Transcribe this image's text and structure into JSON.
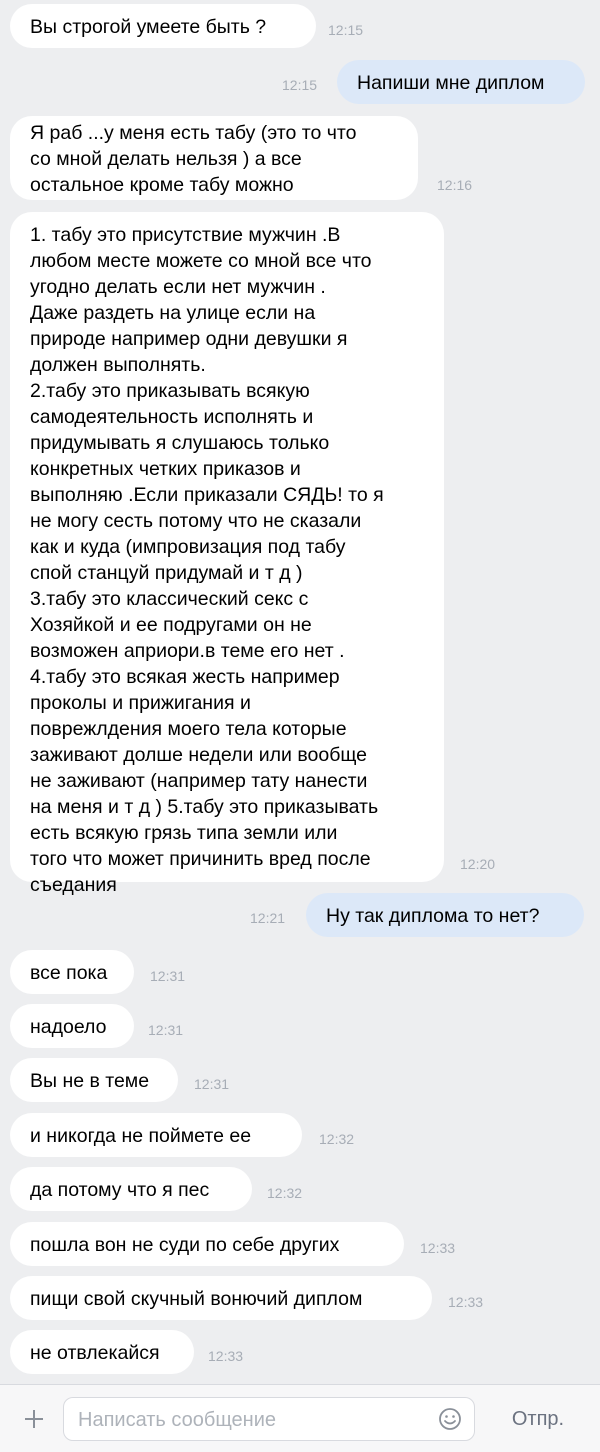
{
  "messages": [
    {
      "dir": "in",
      "text": "Вы строгой умеете быть ?",
      "time": "12:15"
    },
    {
      "dir": "out",
      "text": "Напиши мне диплом",
      "time": "12:15"
    },
    {
      "dir": "in",
      "text": "Я раб ...у меня есть табу (это то что\nсо мной делать нельзя ) а все\nостальное кроме табу можно",
      "time": "12:16"
    },
    {
      "dir": "in",
      "text": "1. табу это присутствие мужчин .В\nлюбом месте можете со мной все что\nугодно делать если нет мужчин .\nДаже раздеть на улице если на\nприроде например одни девушки я\nдолжен выполнять.\n2.табу это приказывать всякую\nсамодеятельность исполнять и\nпридумывать я слушаюсь только\nконкретных четких приказов и\nвыполняю .Если приказали СЯДЬ! то я\nне могу сесть потому что не сказали\nкак и куда (импровизация под табу\nспой станцуй придумай и т д )\n3.табу это классический секс с\nХозяйкой и ее подругами он не\nвозможен априори.в теме его нет .\n4.табу это всякая жесть например\nпроколы и прижигания и\nповрежлдения моего тела которые\nзаживают долше недели или вообще\nне заживают (например тату нанести\nна меня и т д ) 5.табу это приказывать\nесть всякую грязь типа земли или\nтого что может причинить вред после\nсъедания",
      "time": "12:20"
    },
    {
      "dir": "out",
      "text": "Ну так диплома то нет?",
      "time": "12:21"
    },
    {
      "dir": "in",
      "text": "все пока",
      "time": "12:31"
    },
    {
      "dir": "in",
      "text": "надоело",
      "time": "12:31"
    },
    {
      "dir": "in",
      "text": "Вы не в теме",
      "time": "12:31"
    },
    {
      "dir": "in",
      "text": "и никогда не поймете ее",
      "time": "12:32"
    },
    {
      "dir": "in",
      "text": "да потому что я пес",
      "time": "12:32"
    },
    {
      "dir": "in",
      "text": "пошла вон не суди по себе других",
      "time": "12:33"
    },
    {
      "dir": "in",
      "text": "пищи свой скучный вонючий диплом",
      "time": "12:33"
    },
    {
      "dir": "in",
      "text": "не отвлекайся",
      "time": "12:33"
    }
  ],
  "composer": {
    "placeholder": "Написать сообщение",
    "value": "",
    "send_label": "Отпр.",
    "add_icon": "plus-icon",
    "emoji_icon": "smile-icon"
  },
  "colors": {
    "background": "#edeef0",
    "incoming_bubble": "#ffffff",
    "outgoing_bubble": "#dce8f8",
    "timestamp": "#a7adb6"
  }
}
